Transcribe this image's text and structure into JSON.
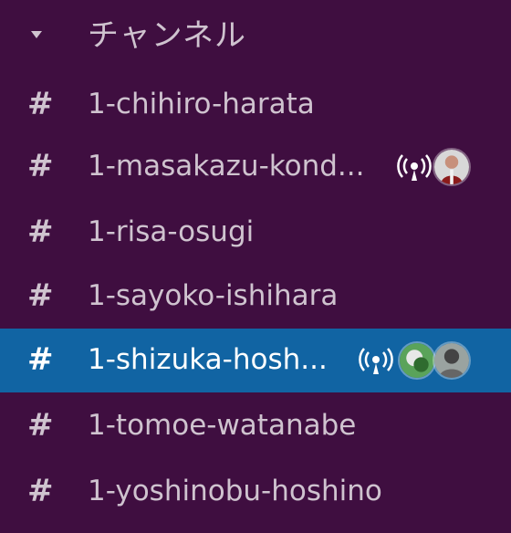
{
  "sidebar": {
    "section_title": "チャンネル",
    "channels": [
      {
        "name": "1-chihiro-harata"
      },
      {
        "name": "1-masakazu-kond..."
      },
      {
        "name": "1-risa-osugi"
      },
      {
        "name": "1-sayoko-ishihara"
      },
      {
        "name": "1-shizuka-hosh..."
      },
      {
        "name": "1-tomoe-watanabe"
      },
      {
        "name": "1-yoshinobu-hoshino"
      }
    ],
    "hash_symbol": "#",
    "selected_channel": "1-shizuka-hosh..."
  },
  "colors": {
    "sidebar_bg": "#3f0e40",
    "selected_bg": "#1164a3",
    "text": "#cfc3cf"
  },
  "icons": [
    "caret-down-icon",
    "hash-icon",
    "huddle-icon",
    "avatar"
  ]
}
